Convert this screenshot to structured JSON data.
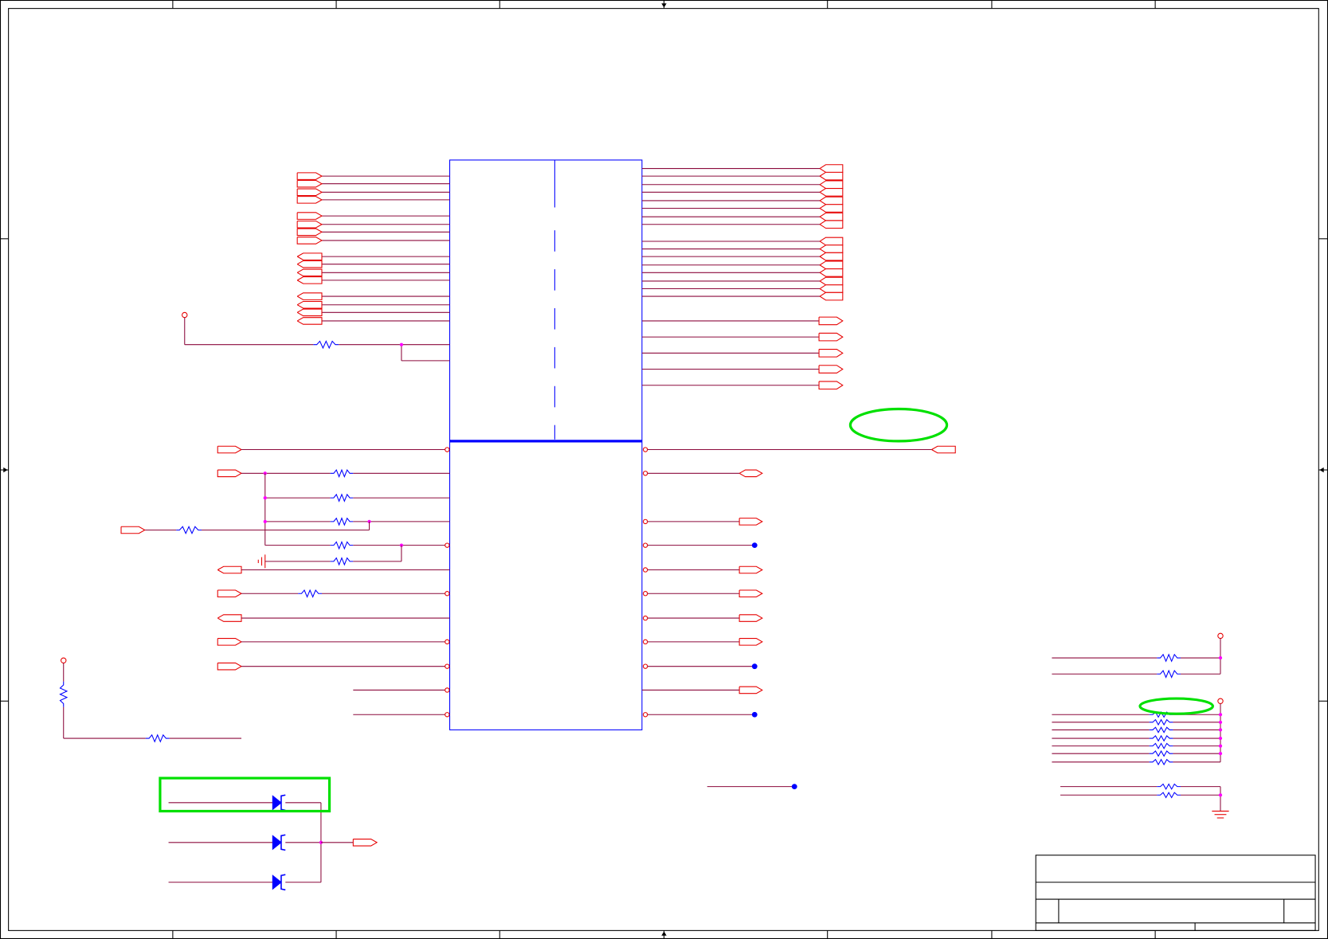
{
  "colors": {
    "background": "#ffffff",
    "frame": "#000000",
    "wire": "#8c0a3c",
    "port": "#e60000",
    "component": "#0000ff",
    "junction": "#ff00ff",
    "highlight": "#00e000"
  },
  "icons": {
    "power": "vcc-symbol-icon",
    "ground": "ground-symbol-icon",
    "no_connect": "no-connect-dot-icon",
    "resistor": "resistor-icon",
    "diode": "diode-icon",
    "port": "port-icon",
    "junction": "junction-dot"
  }
}
